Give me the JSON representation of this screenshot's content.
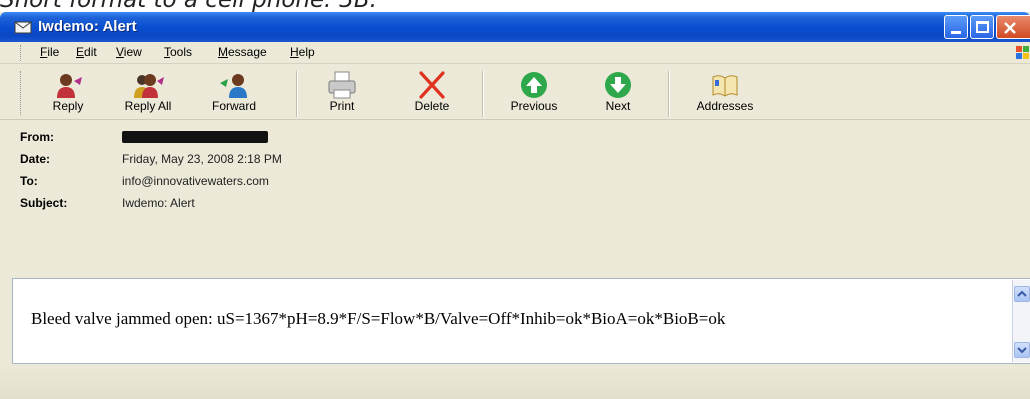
{
  "caption": "Short format to a cell phone: 3B.",
  "window": {
    "title": "Iwdemo: Alert"
  },
  "menu": {
    "items": [
      {
        "mnemonic": "F",
        "rest": "ile"
      },
      {
        "mnemonic": "E",
        "rest": "dit"
      },
      {
        "mnemonic": "V",
        "rest": "iew"
      },
      {
        "mnemonic": "T",
        "rest": "ools"
      },
      {
        "mnemonic": "M",
        "rest": "essage"
      },
      {
        "mnemonic": "H",
        "rest": "elp"
      }
    ]
  },
  "toolbar": {
    "reply": "Reply",
    "reply_all": "Reply All",
    "forward": "Forward",
    "print": "Print",
    "delete": "Delete",
    "previous": "Previous",
    "next": "Next",
    "addresses": "Addresses"
  },
  "header": {
    "from_label": "From:",
    "date_label": "Date:",
    "date_value": "Friday, May 23, 2008 2:18 PM",
    "to_label": "To:",
    "to_value": "info@innovativewaters.com",
    "subject_label": "Subject:",
    "subject_value": "Iwdemo: Alert"
  },
  "body": {
    "text": "Bleed valve jammed open: uS=1367*pH=8.9*F/S=Flow*B/Valve=Off*Inhib=ok*BioA=ok*BioB=ok"
  },
  "colors": {
    "titlebar": "#0a4fd0",
    "chrome": "#ece9d8",
    "delete_red": "#e0301e",
    "nav_green": "#2ea84a"
  }
}
